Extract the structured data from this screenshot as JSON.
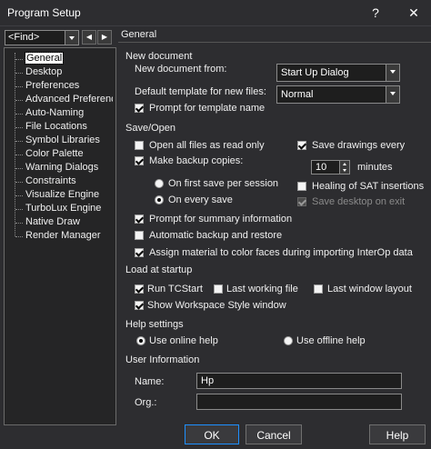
{
  "window": {
    "title": "Program Setup",
    "help_glyph": "?",
    "close_glyph": "✕"
  },
  "left": {
    "find_combo": "<Find>",
    "nav_back": "◀",
    "nav_forward": "▶",
    "tree": [
      "General",
      "Desktop",
      "Preferences",
      "Advanced Preference",
      "Auto-Naming",
      "File Locations",
      "Symbol Libraries",
      "Color Palette",
      "Warning Dialogs",
      "Constraints",
      "Visualize Engine",
      "TurboLux Engine",
      "Native Draw",
      "Render Manager"
    ]
  },
  "main": {
    "header": "General",
    "new_document": {
      "title": "New document",
      "from_label": "New document from:",
      "from_value": "Start Up Dialog",
      "template_label": "Default template for new files:",
      "template_value": "Normal",
      "prompt_template": "Prompt for template name"
    },
    "save_open": {
      "title": "Save/Open",
      "open_read_only": "Open all files as read only",
      "make_backup": "Make backup copies:",
      "first_save": "On first save per session",
      "every_save": "On every save",
      "save_drawings": "Save drawings every",
      "minutes_value": "10",
      "minutes_label": "minutes",
      "healing": "Healing of SAT insertions",
      "save_desktop": "Save desktop on exit",
      "prompt_summary": "Prompt for summary information",
      "auto_backup": "Automatic backup and restore",
      "assign_material": "Assign material to color faces during importing InterOp data"
    },
    "startup": {
      "title": "Load at startup",
      "run_tcstart": "Run TCStart",
      "last_working": "Last working file",
      "last_window": "Last window layout",
      "show_workspace": "Show Workspace Style window"
    },
    "help": {
      "title": "Help settings",
      "online": "Use online help",
      "offline": "Use offline help"
    },
    "user": {
      "title": "User Information",
      "name_label": "Name:",
      "name_value": "Hp",
      "org_label": "Org.:",
      "org_value": ""
    }
  },
  "buttons": {
    "ok": "OK",
    "cancel": "Cancel",
    "help": "Help"
  }
}
